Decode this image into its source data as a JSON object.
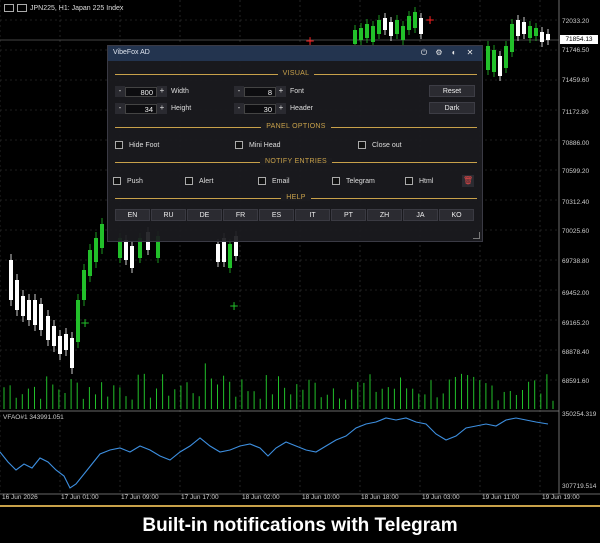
{
  "chart": {
    "symbol_label": "JPN225, H1: Japan 225 Index",
    "current_price": "71854.13",
    "price_ticks": [
      "72033.20",
      "71746.50",
      "71459.60",
      "71172.80",
      "70886.00",
      "70599.20",
      "70312.40",
      "70025.60",
      "69738.80",
      "69452.00",
      "69165.20",
      "68878.40",
      "68591.60"
    ],
    "indicator_label": "VFAO#1 343991.051",
    "indicator_ticks": [
      "350254.319",
      "307719.514"
    ],
    "time_ticks": [
      "16 Jun 2026",
      "17 Jun 01:00",
      "17 Jun 09:00",
      "17 Jun 17:00",
      "18 Jun 02:00",
      "18 Jun 10:00",
      "18 Jun 18:00",
      "19 Jun 03:00",
      "19 Jun 11:00",
      "19 Jun 19:00"
    ]
  },
  "panel": {
    "title": "VibeFox AD",
    "icons": [
      "power-icon",
      "settings-icon",
      "theme-icon",
      "close-icon"
    ],
    "sections": {
      "visual": "VISUAL",
      "panel_options": "PANEL OPTIONS",
      "notify_entries": "NOTIFY ENTRIES",
      "help": "HELP"
    },
    "visual": {
      "width": {
        "value": "800",
        "label": "Width"
      },
      "height": {
        "value": "34",
        "label": "Height"
      },
      "font": {
        "value": "8",
        "label": "Font"
      },
      "header": {
        "value": "30",
        "label": "Header"
      },
      "minus": "-",
      "plus": "+",
      "reset_label": "Reset",
      "dark_label": "Dark"
    },
    "panel_options": {
      "hide_foot": "Hide Foot",
      "mini_head": "Mini Head",
      "close_out": "Close out"
    },
    "notify": {
      "push": "Push",
      "alert": "Alert",
      "email": "Email",
      "telegram": "Telegram",
      "html": "Html"
    },
    "languages": [
      "EN",
      "RU",
      "DE",
      "FR",
      "ES",
      "IT",
      "PT",
      "ZH",
      "JA",
      "KO"
    ]
  },
  "caption": "Built-in notifications with Telegram",
  "colors": {
    "bull": "#22c02a",
    "bear": "#ffffff",
    "indicator_line": "#3d8fe0",
    "accent_gold": "#c8a14a",
    "panel_header": "#23344f",
    "marker_red": "#ff2222"
  }
}
